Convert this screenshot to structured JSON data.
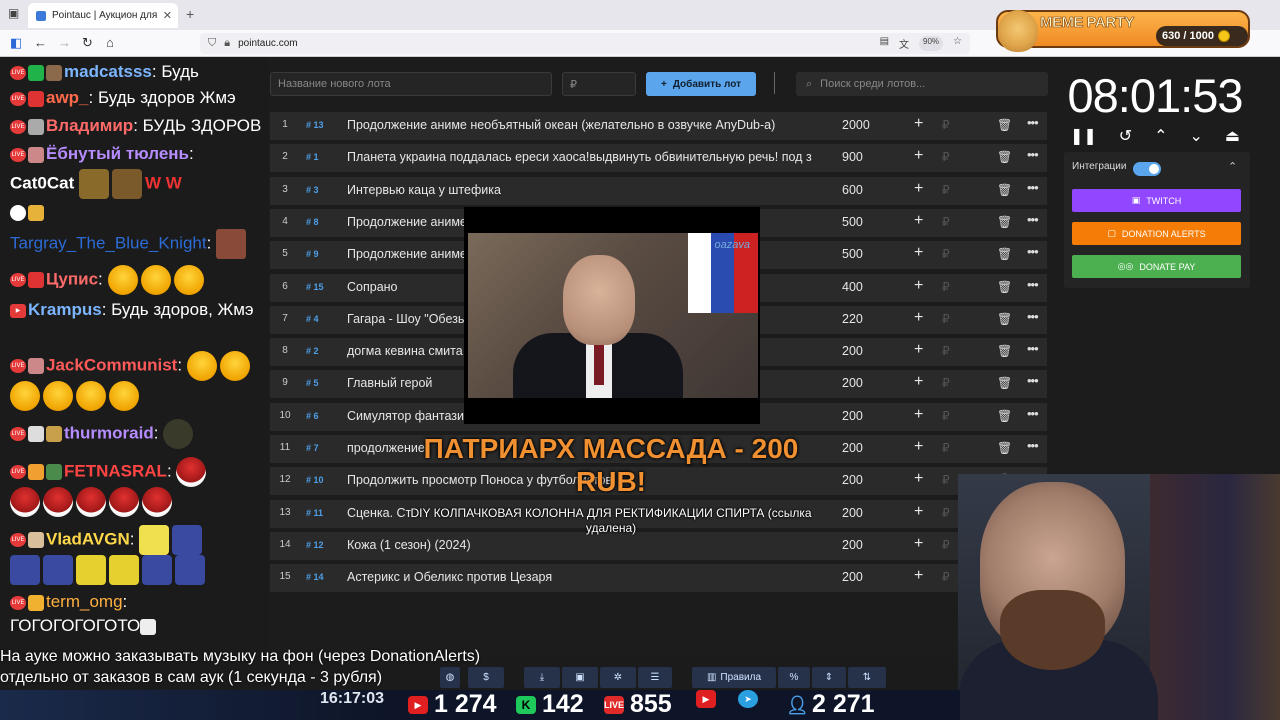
{
  "browser": {
    "tab_title": "Pointauc | Аукцион для стримеров",
    "url": "pointauc.com",
    "zoom": "90%"
  },
  "meme_party": {
    "title": "MEME PARTY",
    "count": "630 / 1000"
  },
  "chat": [
    {
      "nick": "madcatsss",
      "text": " Будь",
      "color": "#7bb5ff"
    },
    {
      "nick": "awp_",
      "text": " Будь здоров Жмэ",
      "color": "#ff6a4a"
    },
    {
      "nick": "Владимир",
      "text": " БУДЬ ЗДОРОВ",
      "color": "#ff6a6a"
    },
    {
      "nick": "Ёбнутый тюлень",
      "text": "",
      "color": "#b68cff"
    },
    {
      "nick": "Cat0Cat",
      "text": "",
      "color": "#ffffff"
    },
    {
      "nick": "Targray_The_Blue_Knight",
      "text": "",
      "color": "#2c6bd4"
    },
    {
      "nick": "Цупис",
      "text": "",
      "color": "#ff6a6a"
    },
    {
      "nick": "Krampus",
      "text": " Будь здоров, Жмэ",
      "color": "#7bb5ff"
    },
    {
      "nick": "JackCommunist",
      "text": "",
      "color": "#ff5a5a"
    },
    {
      "nick": "thurmoraid",
      "text": "",
      "color": "#b68cff"
    },
    {
      "nick": "FETNASRAL",
      "text": "",
      "color": "#ff4444"
    },
    {
      "nick": "VladAVGN",
      "text": "",
      "color": "#ffd84a"
    },
    {
      "nick": "term_omg",
      "text": "",
      "color": "#ffb040"
    },
    {
      "nick": "",
      "text": "ГОГОГОГОГОТО",
      "color": "#ffffff"
    }
  ],
  "toolbar": {
    "new_lot_placeholder": "Название нового лота",
    "amount_placeholder": "₽",
    "add_lot_label": "Добавить лот",
    "search_placeholder": "Поиск среди лотов..."
  },
  "lots": [
    {
      "n": "1",
      "id": "13",
      "name": "Продолжение аниме необъятный океан (желательно в озвучке AnyDub-а)",
      "amount": "2000"
    },
    {
      "n": "2",
      "id": "1",
      "name": "Планета украина поддалась ереси хаоса!выдвинуть обвинительную речь! под з",
      "amount": "900"
    },
    {
      "n": "3",
      "id": "3",
      "name": "Интервью каца у штефика",
      "amount": "600"
    },
    {
      "n": "4",
      "id": "8",
      "name": "Продолжение аниме",
      "amount": "500"
    },
    {
      "n": "5",
      "id": "9",
      "name": "Продолжение аниме",
      "amount": "500"
    },
    {
      "n": "6",
      "id": "15",
      "name": "Сопрано",
      "amount": "400"
    },
    {
      "n": "7",
      "id": "4",
      "name": "Гагара - Шоу \"Обезь",
      "amount": "220"
    },
    {
      "n": "8",
      "id": "2",
      "name": "догма кевина смита",
      "amount": "200"
    },
    {
      "n": "9",
      "id": "5",
      "name": "Главный герой",
      "amount": "200"
    },
    {
      "n": "10",
      "id": "6",
      "name": "Симулятор фантазии",
      "amount": "200"
    },
    {
      "n": "11",
      "id": "7",
      "name": "продолжение",
      "amount": "200"
    },
    {
      "n": "12",
      "id": "10",
      "name": "Продолжить просмотр Поноса у футболистов",
      "amount": "200"
    },
    {
      "n": "13",
      "id": "11",
      "name": "Сценка. Ст",
      "amount": "200"
    },
    {
      "n": "14",
      "id": "12",
      "name": "Кожа (1 сезон) (2024)",
      "amount": "200"
    },
    {
      "n": "15",
      "id": "14",
      "name": "Астерикс и Обеликс против Цезаря",
      "amount": "200"
    }
  ],
  "timer": "08:01:53",
  "integrations": {
    "label": "Интеграции",
    "twitch": "TWITCH",
    "donation_alerts": "DONATION ALERTS",
    "donate_pay": "DONATE PAY"
  },
  "overlay": {
    "watermark": "oazava",
    "alert_title": "ПАТРИАРХ МАССАДА - 200 RUB!",
    "alert_message": "DIY КОЛПАЧКОВАЯ КОЛОННА ДЛЯ РЕКТИФИКАЦИИ СПИРТА (ссылка удалена)",
    "info_line1": "На ауке можно заказывать музыку на фон (через DonationAlerts)",
    "info_line2": "отдельно от заказов в сам аук (1 секунда - 3 рубля)",
    "rules_label": "Правила"
  },
  "stats": {
    "clock": "16:17:03",
    "youtube": "1 274",
    "kick": "142",
    "vk": "855",
    "telegram_viewers": "2 271"
  },
  "colors": {
    "accent": "#5aa5ec",
    "twitch": "#9146ff",
    "donation_alerts": "#f57d07",
    "donate_pay": "#4caf50"
  }
}
